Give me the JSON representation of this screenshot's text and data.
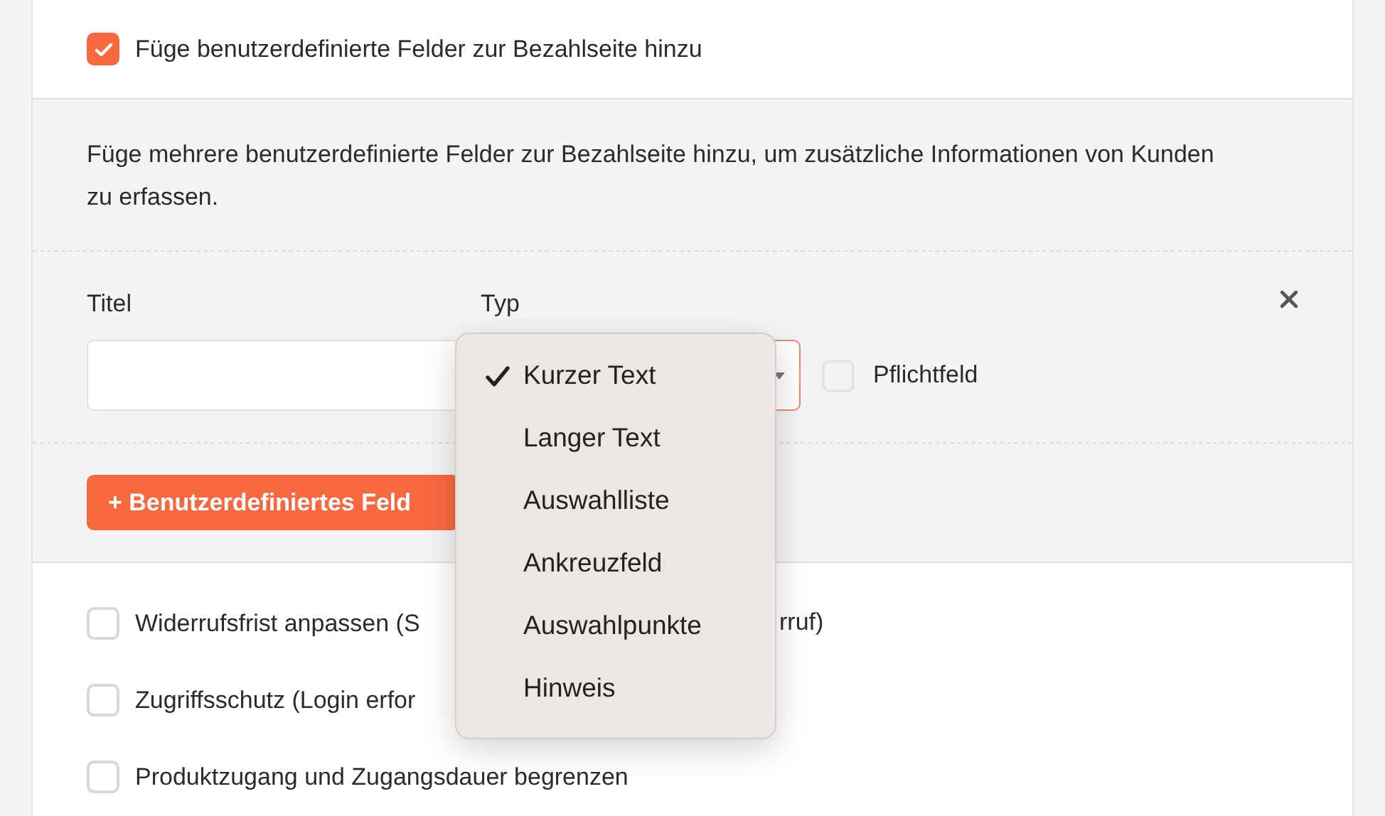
{
  "enable_custom_fields": {
    "label": "Füge benutzerdefinierte Felder zur Bezahlseite hinzu",
    "checked": true
  },
  "description": "Füge mehrere benutzerdefinierte Felder zur Bezahlseite hinzu, um zusätzliche Informationen von Kunden zu erfassen.",
  "custom_field": {
    "title_label": "Titel",
    "type_label": "Typ",
    "type_focused": true,
    "required": {
      "label": "Pflichtfeld",
      "checked": false,
      "disabled": true
    }
  },
  "add_button": "+ Benutzerdefiniertes Feld",
  "type_menu": [
    {
      "label": "Kurzer Text",
      "selected": true
    },
    {
      "label": "Langer Text",
      "selected": false
    },
    {
      "label": "Auswahlliste",
      "selected": false
    },
    {
      "label": "Ankreuzfeld",
      "selected": false
    },
    {
      "label": "Auswahlpunkte",
      "selected": false
    },
    {
      "label": "Hinweis",
      "selected": false
    }
  ],
  "options": [
    {
      "label": "Widerrufsfrist anpassen (S",
      "label_tail": "rruf)",
      "checked": false
    },
    {
      "label": "Zugriffsschutz (Login erfor",
      "checked": false
    },
    {
      "label": "Produktzugang und Zugangsdauer begrenzen",
      "checked": false
    }
  ]
}
